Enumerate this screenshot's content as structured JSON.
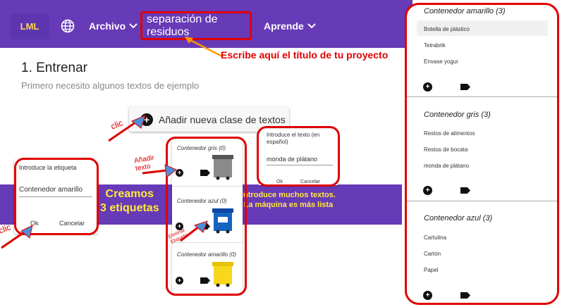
{
  "header": {
    "logo": "LML",
    "globe_icon": "globe-icon",
    "archivo": "Archivo",
    "title_value": "separación de residuos",
    "aprende": "Aprende"
  },
  "annotations": {
    "title_hint": "Escribe aquí el título de tu proyecto",
    "clic_1": "clic",
    "clic_2": "clic",
    "add_text": "Añadir\ntexto",
    "creamos": "Creamos\n3 etiquetas",
    "introduce_muchos": "Introduce muchos textos.\nLa máquina es más lista",
    "eliminar": "Eliminar\nEtiqueta"
  },
  "train": {
    "heading": "1. Entrenar",
    "subtitle": "Primero necesito algunos textos de ejemplo",
    "add_class": "Añadir nueva clase de textos"
  },
  "label_dialog": {
    "prompt": "Introduce la etiqueta",
    "value": "Contenedor amarillo",
    "ok": "Ok",
    "cancel": "Cancelar"
  },
  "text_dialog": {
    "prompt": "Introduce el texto (en español)",
    "value": "monda de plátano",
    "ok": "Ok",
    "cancel": "Cancelar"
  },
  "mini_cards": [
    {
      "title": "Contenedor gris (0)",
      "color": "#7a7a7a"
    },
    {
      "title": "Contenedor azul (0)",
      "color": "#1565c0"
    },
    {
      "title": "Contenedor amarillo (0)",
      "color": "#f9d71c"
    }
  ],
  "right_panel": {
    "sections": [
      {
        "title": "Contenedor amarillo (3)",
        "items": [
          "Botella de plástico",
          "Tetrabrik",
          "Envase yogur"
        ]
      },
      {
        "title": "Contenedor gris (3)",
        "items": [
          "Restos de alimentos",
          "Restos de bocata",
          "monda de plátano"
        ]
      },
      {
        "title": "Contenedor azul (3)",
        "items": [
          "Cartulina",
          "Cartón",
          "Papel"
        ]
      }
    ]
  },
  "colors": {
    "purple": "#673ab7",
    "red": "#e00000",
    "yellow": "#ffeb3b",
    "orange": "#ff9800"
  }
}
